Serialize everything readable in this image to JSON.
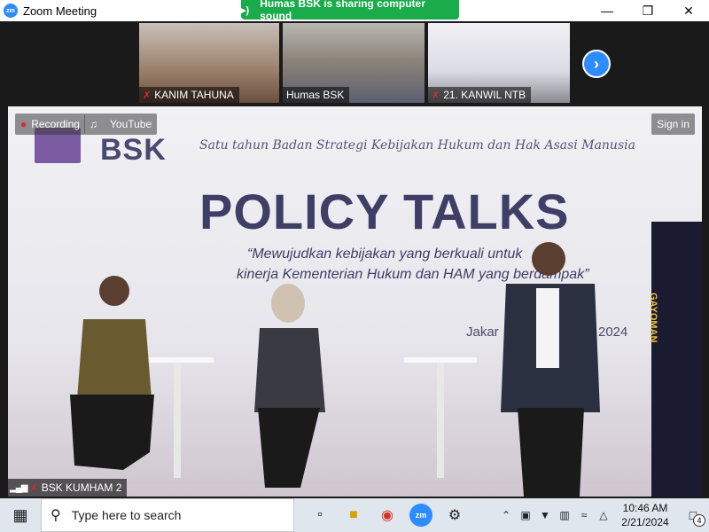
{
  "window": {
    "title": "Zoom Meeting",
    "app_icon": "zm",
    "controls": [
      "minimize-icon",
      "maximize-icon",
      "close-icon"
    ]
  },
  "share_banner": {
    "text": "Humas BSK is sharing computer sound",
    "icon": "speaker-icon"
  },
  "thumbnails": [
    {
      "label": "KANIM TAHUNA",
      "muted": true
    },
    {
      "label": "Humas BSK",
      "muted": false
    },
    {
      "label": "21. KANWIL NTB",
      "muted": true
    }
  ],
  "main_video": {
    "recording_label": "Recording",
    "youtube_label": "YouTube",
    "sign_in_label": "Sign in",
    "backdrop": {
      "bsk": "BSK",
      "slogan": "Satu tahun Badan Strategi Kebijakan Hukum dan Hak Asasi Manusia",
      "title": "POLICY TALKS",
      "subtitle_line1": "“Mewujudkan kebijakan yang berkuali untuk",
      "subtitle_line2": "kinerja Kementerian Hukum dan HAM yang berdampak”",
      "date_left": "Jakar",
      "date_right": "2024",
      "gate": "GAYOMAN"
    },
    "participant_label": "BSK KUMHAM 2"
  },
  "taskbar": {
    "search_placeholder": "Type here to search",
    "time": "10:46 AM",
    "date": "2/21/2024",
    "notification_count": "4"
  }
}
